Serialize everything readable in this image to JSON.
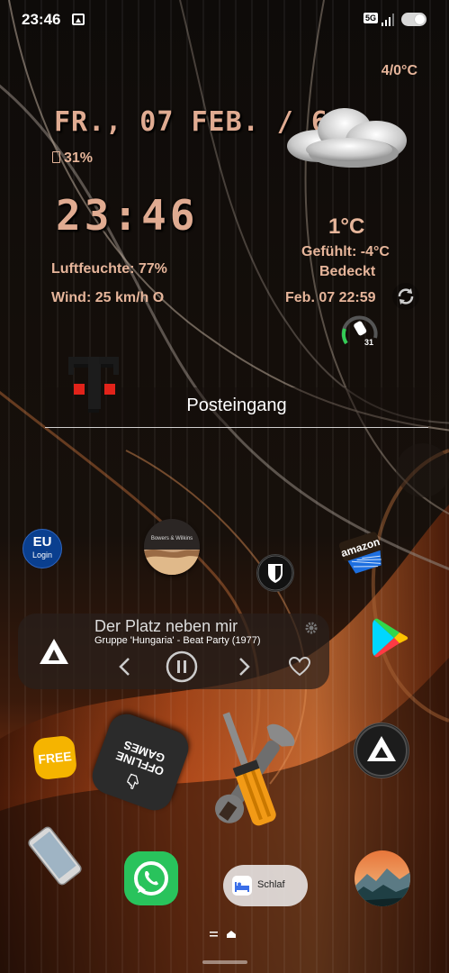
{
  "status_bar": {
    "time": "23:46",
    "network": "5G"
  },
  "weather_widget": {
    "date": "FR., 07 FEB. / 6",
    "battery": "31%",
    "clock": "23:46",
    "humidity": "Luftfeuchte: 77%",
    "wind": "Wind: 25 km/h O",
    "temp_range": "4/0°C",
    "current_temp": "1°C",
    "feels_like": "Gefühlt: -4°C",
    "condition": "Bedeckt",
    "updated": "Feb. 07  22:59",
    "steps_value": "31",
    "accent_color": "#e0ab91"
  },
  "mail_widget": {
    "title": "Posteingang"
  },
  "apps": {
    "eu_login_line1": "EU",
    "eu_login_line2": "Login",
    "bowers_wilkins": "Bowers & Wilkins",
    "free": "FREE",
    "offline_games": "OFFLINE\nGAMES"
  },
  "music_widget": {
    "title": "Der Platz neben mir",
    "artist": "Gruppe 'Hungaria' - Beat Party (1977)"
  },
  "dock": {
    "sleep_label": "Schlaf"
  }
}
